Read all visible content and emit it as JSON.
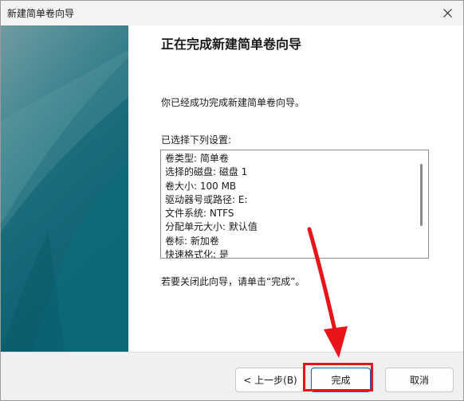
{
  "window": {
    "title": "新建简单卷向导"
  },
  "main": {
    "heading": "正在完成新建简单卷向导",
    "description": "你已经成功完成新建简单卷向导。",
    "settings_label": "已选择下列设置:",
    "settings": [
      "卷类型: 简单卷",
      "选择的磁盘: 磁盘 1",
      "卷大小: 100 MB",
      "驱动器号或路径: E:",
      "文件系统: NTFS",
      "分配单元大小: 默认值",
      "卷标: 新加卷",
      "快速格式化: 是"
    ],
    "close_hint": "若要关闭此向导，请单击“完成”。"
  },
  "buttons": {
    "back": "< 上一步(B)",
    "finish": "完成",
    "cancel": "取消"
  },
  "annotation": {
    "color": "#e8141a"
  }
}
